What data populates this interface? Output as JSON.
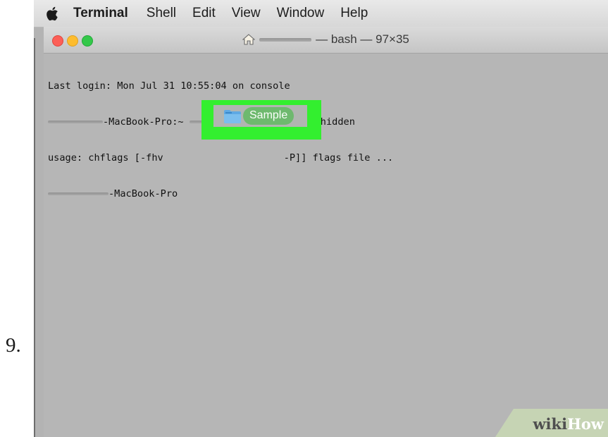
{
  "step": {
    "number": "9."
  },
  "menubar": {
    "apple_icon": "apple-logo-icon",
    "app_name": "Terminal",
    "items": [
      "Shell",
      "Edit",
      "View",
      "Window",
      "Help"
    ]
  },
  "window": {
    "title_suffix": "— bash — 97×35",
    "home_icon": "home-icon",
    "traffic_lights": {
      "close": "#fc5f57",
      "minimize": "#fdbc2e",
      "zoom": "#34c84a"
    }
  },
  "terminal": {
    "line1": "Last login: Mon Jul 31 10:55:04 on console",
    "line2_host": "-MacBook-Pro:~",
    "line2_cmd": "chflags   hidden",
    "line3": "usage: chflags [-fhv",
    "line3_tail": "-P]] flags file ...",
    "line4_host": "-MacBook-Pro"
  },
  "drag_overlay": {
    "folder_icon": "folder-icon",
    "label": "Sample",
    "highlight_color": "#33ef2f"
  },
  "watermark": {
    "wiki": "wiki",
    "how": "How"
  }
}
